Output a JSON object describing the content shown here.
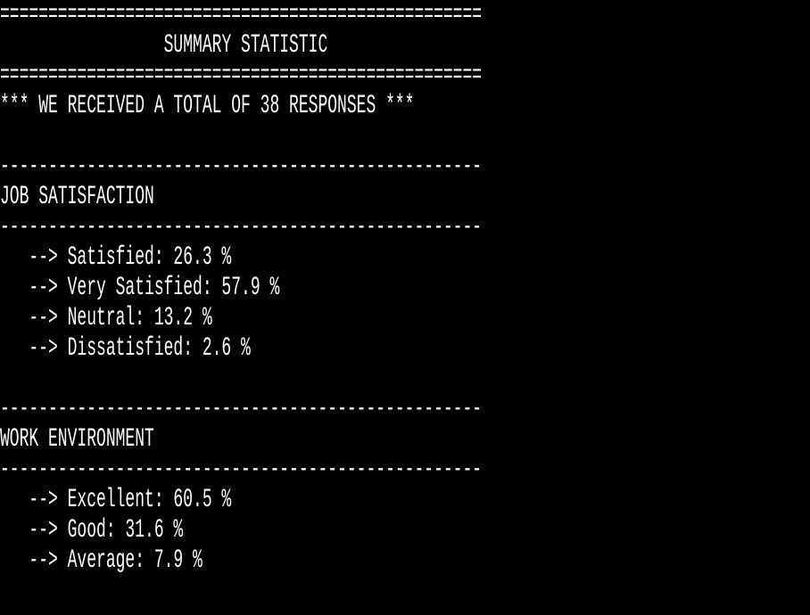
{
  "terminal": {
    "double_rule": "==================================================",
    "title": "                 SUMMARY STATISTIC",
    "total_banner": "*** WE RECEIVED A TOTAL OF 38 RESPONSES ***",
    "single_rule": "--------------------------------------------------",
    "sections": [
      {
        "heading": "JOB SATISFACTION",
        "items": [
          "--> Satisfied: 26.3 %",
          "--> Very Satisfied: 57.9 %",
          "--> Neutral: 13.2 %",
          "--> Dissatisfied: 2.6 %"
        ]
      },
      {
        "heading": "WORK ENVIRONMENT",
        "items": [
          "--> Excellent: 60.5 %",
          "--> Good: 31.6 %",
          "--> Average: 7.9 %"
        ]
      }
    ]
  },
  "colors": {
    "background": "#000000",
    "foreground": "#ffffff"
  }
}
